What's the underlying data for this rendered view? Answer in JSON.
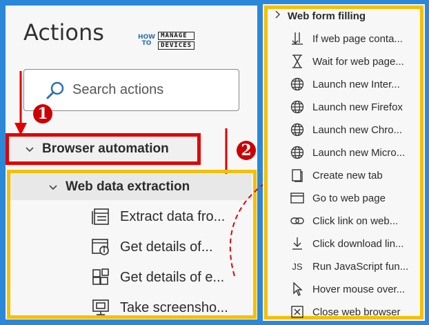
{
  "left": {
    "title": "Actions",
    "logo": {
      "how": "HOW\nTO",
      "line1": "MANAGE",
      "line2": "DEVICES"
    },
    "search": {
      "placeholder": "Search actions"
    },
    "badges": [
      "1",
      "2"
    ],
    "browser_automation": {
      "label": "Browser automation"
    },
    "web_data_extraction": {
      "label": "Web data extraction"
    },
    "items": [
      {
        "label": "Extract data fro...",
        "icon": "table-extract-icon"
      },
      {
        "label": "Get details of...",
        "icon": "webpage-info-icon"
      },
      {
        "label": "Get details of e...",
        "icon": "element-grid-icon"
      },
      {
        "label": "Take screensho...",
        "icon": "screenshot-icon"
      }
    ]
  },
  "right": {
    "header": {
      "label": "Web form filling"
    },
    "items": [
      {
        "label": "If web page conta...",
        "icon": "branch-icon"
      },
      {
        "label": "Wait for web page...",
        "icon": "hourglass-icon"
      },
      {
        "label": "Launch new Inter...",
        "icon": "globe-icon"
      },
      {
        "label": "Launch new Firefox",
        "icon": "globe-icon"
      },
      {
        "label": "Launch new Chro...",
        "icon": "globe-icon"
      },
      {
        "label": "Launch new Micro...",
        "icon": "globe-icon"
      },
      {
        "label": "Create new tab",
        "icon": "new-tab-icon"
      },
      {
        "label": "Go to web page",
        "icon": "window-icon"
      },
      {
        "label": "Click link on web...",
        "icon": "link-icon"
      },
      {
        "label": "Click download lin...",
        "icon": "download-icon"
      },
      {
        "label": "Run JavaScript fun...",
        "icon": "js-icon",
        "glyph": "JS"
      },
      {
        "label": "Hover mouse over...",
        "icon": "cursor-icon"
      },
      {
        "label": "Close web browser",
        "icon": "close-box-icon"
      }
    ]
  },
  "colors": {
    "frame": "#2b88d8",
    "highlight_red": "#e00000",
    "highlight_yellow": "#f5c000",
    "badge": "#cc0000"
  }
}
